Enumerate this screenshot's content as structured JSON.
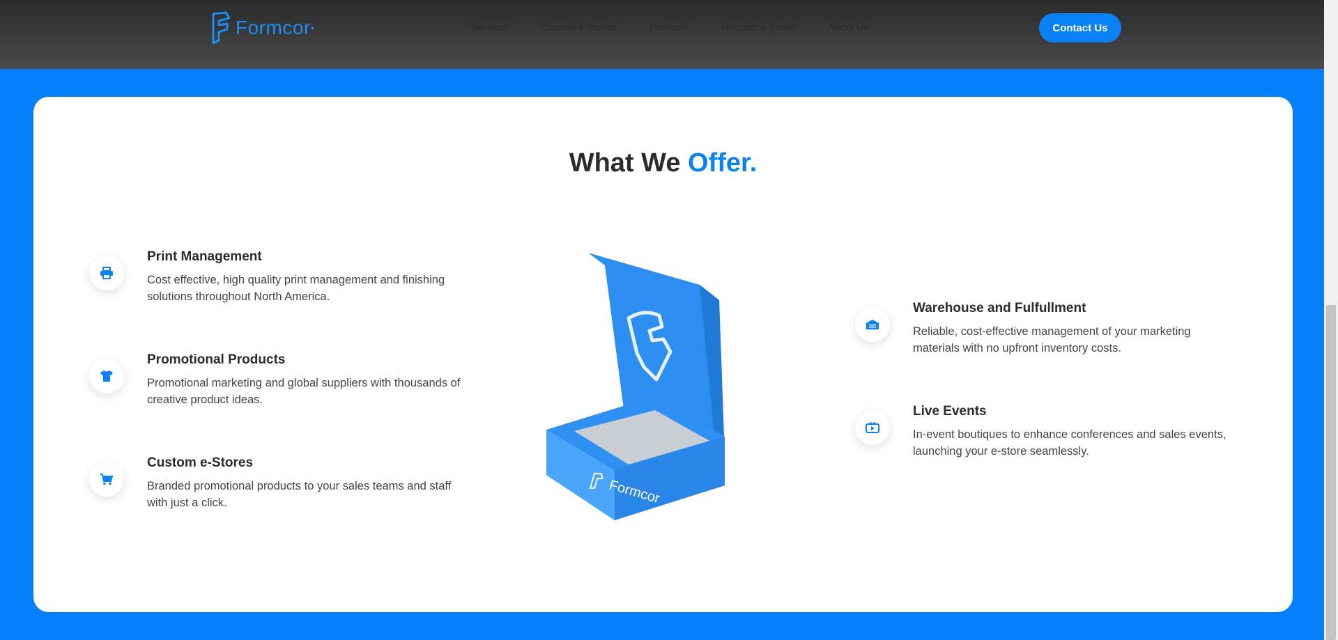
{
  "header": {
    "brand": "Formcor",
    "nav": [
      "Services",
      "Custom e-Stores",
      "Products",
      "Request a Quote",
      "About Us"
    ],
    "cta": "Contact Us"
  },
  "section": {
    "heading_main": "What We",
    "heading_accent": "Offer.",
    "features": [
      {
        "icon": "printer-icon",
        "title": "Print Management",
        "desc": "Cost effective, high quality print management and finishing solutions throughout North America."
      },
      {
        "icon": "tshirt-icon",
        "title": "Promotional Products",
        "desc": "Promotional marketing and global suppliers with thousands of creative product ideas."
      },
      {
        "icon": "cart-icon",
        "title": "Custom e-Stores",
        "desc": "Branded promotional products to your sales teams and staff with just a click."
      },
      {
        "icon": "warehouse-icon",
        "title": "Warehouse and Fulfullment",
        "desc": "Reliable, cost-effective management of your marketing materials with no upfront inventory costs."
      },
      {
        "icon": "tv-play-icon",
        "title": "Live Events",
        "desc": "In-event boutiques to enhance conferences and sales events, launching your e-store seamlessly."
      }
    ],
    "box_brand": "Formcor"
  },
  "colors": {
    "accent": "#0a82f5",
    "background": "#0582fb",
    "header": "#3a3a3a"
  }
}
